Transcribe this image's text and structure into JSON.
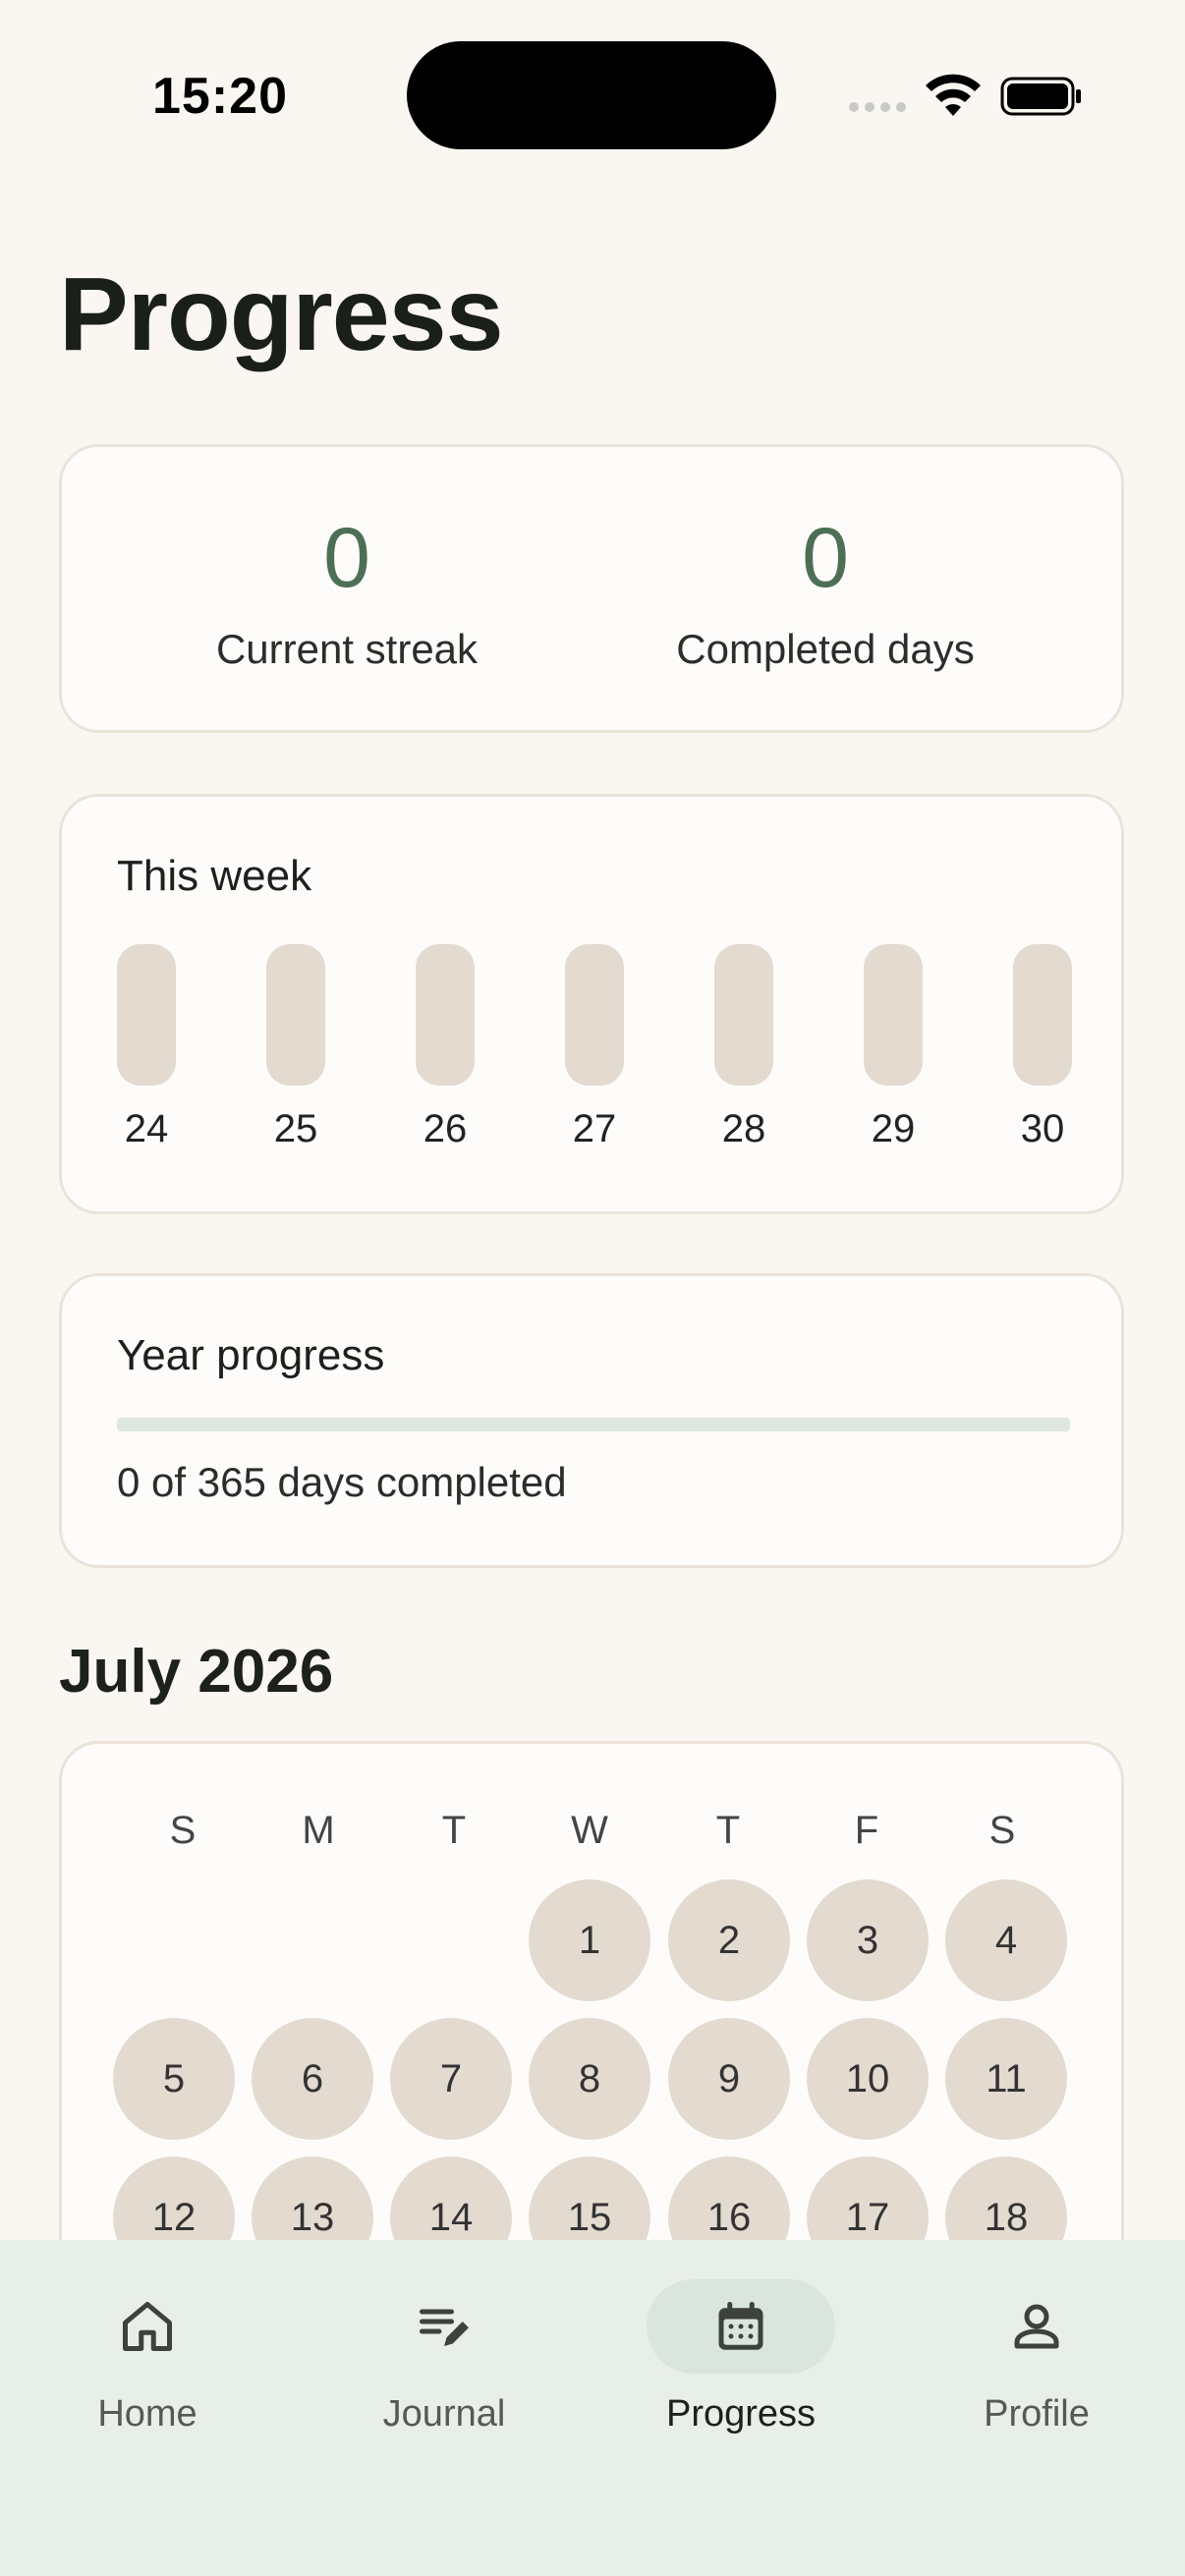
{
  "status_bar": {
    "time": "15:20"
  },
  "page": {
    "title": "Progress"
  },
  "stats": {
    "streak_value": "0",
    "streak_label": "Current streak",
    "completed_value": "0",
    "completed_label": "Completed days"
  },
  "week": {
    "title": "This week",
    "days": [
      "24",
      "25",
      "26",
      "27",
      "28",
      "29",
      "30"
    ]
  },
  "year_progress": {
    "title": "Year progress",
    "fraction": 0,
    "text": "0 of 365 days completed"
  },
  "calendar": {
    "month_title": "July 2026",
    "weekdays": [
      "S",
      "M",
      "T",
      "W",
      "T",
      "F",
      "S"
    ],
    "first_weekday_index": 3,
    "visible_days": [
      "1",
      "2",
      "3",
      "4",
      "5",
      "6",
      "7",
      "8",
      "9",
      "10",
      "11",
      "12",
      "13",
      "14",
      "15",
      "16",
      "17",
      "18"
    ]
  },
  "bottom_nav": {
    "items": [
      {
        "label": "Home",
        "icon": "home-icon",
        "active": false
      },
      {
        "label": "Journal",
        "icon": "journal-edit-icon",
        "active": false
      },
      {
        "label": "Progress",
        "icon": "calendar-icon",
        "active": true
      },
      {
        "label": "Profile",
        "icon": "person-icon",
        "active": false
      }
    ]
  },
  "colors": {
    "background": "#faf7f2",
    "accent": "#4c6f55",
    "pill": "#e3dbd0",
    "nav_background": "#e8eee8",
    "nav_active_pill": "#d9e5de"
  }
}
